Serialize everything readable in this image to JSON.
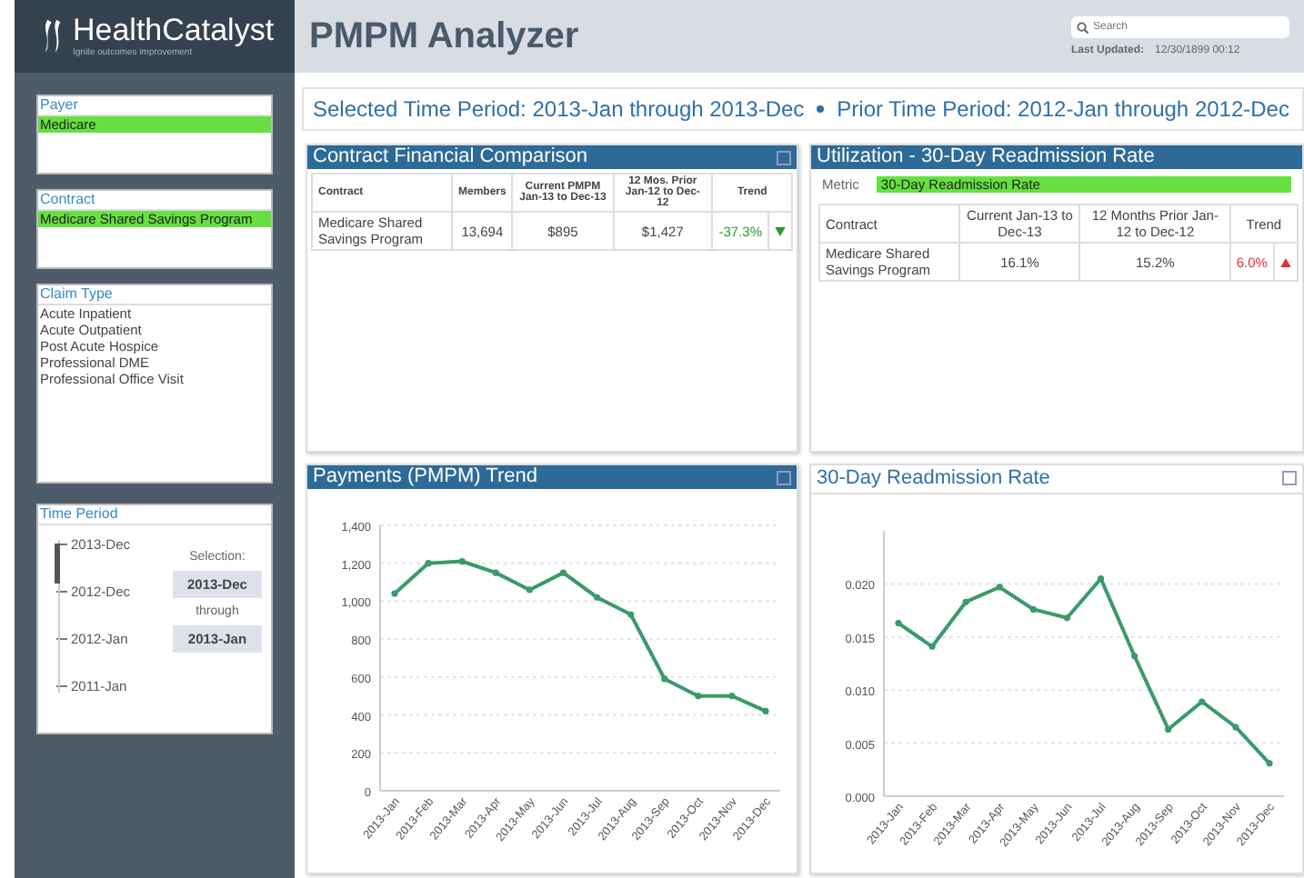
{
  "brand": {
    "name": "HealthCatalyst",
    "tagline": "Ignite outcomes improvement"
  },
  "app_title": "PMPM Analyzer",
  "search": {
    "placeholder": "Search"
  },
  "last_updated": {
    "label": "Last Updated:",
    "value": "12/30/1899 00:12"
  },
  "filters": [
    {
      "title": "Payer",
      "kind": "list",
      "items": [
        {
          "label": "Medicare",
          "selected": true
        }
      ]
    },
    {
      "title": "Contract",
      "kind": "list",
      "items": [
        {
          "label": "Medicare Shared Savings Program",
          "selected": true
        }
      ]
    },
    {
      "title": "Claim Type",
      "kind": "list",
      "items": [
        {
          "label": "Acute Inpatient",
          "selected": false
        },
        {
          "label": "Acute Outpatient",
          "selected": false
        },
        {
          "label": "Post Acute Hospice",
          "selected": false
        },
        {
          "label": "Professional DME",
          "selected": false
        },
        {
          "label": "Professional Office Visit",
          "selected": false
        }
      ]
    }
  ],
  "time_period": {
    "title": "Time Period",
    "ticks": [
      "2013-Dec",
      "2012-Dec",
      "2012-Jan",
      "2011-Jan"
    ],
    "selection_label": "Selection:",
    "from": "2013-Dec",
    "through_label": "through",
    "to": "2013-Jan"
  },
  "period_banner": {
    "selected": "Selected Time Period: 2013-Jan through 2013-Dec",
    "prior": "Prior Time Period: 2012-Jan through 2012-Dec"
  },
  "financial": {
    "title": "Contract Financial Comparison",
    "columns": [
      "Contract",
      "Members",
      "Current PMPM Jan-13 to Dec-13",
      "12 Mos. Prior Jan-12 to Dec-12",
      "Trend"
    ],
    "rows": [
      {
        "contract": "Medicare Shared Savings Program",
        "members": "13,694",
        "current": "$895",
        "prior": "$1,427",
        "trend": "-37.3%",
        "rising": false
      }
    ]
  },
  "utilization": {
    "title": "Utilization - 30-Day Readmission Rate",
    "metric_label": "Metric",
    "metric_value": "30-Day Readmission Rate",
    "columns": [
      "Contract",
      "Current Jan-13 to Dec-13",
      "12 Months Prior Jan-12 to Dec-12",
      "Trend"
    ],
    "rows": [
      {
        "contract": "Medicare Shared Savings Program",
        "current": "16.1%",
        "prior": "15.2%",
        "trend": "6.0%",
        "rising": true
      }
    ]
  },
  "payments": {
    "title": "Payments (PMPM) Trend",
    "chart_data": {
      "type": "line",
      "categories": [
        "2013-Jan",
        "2013-Feb",
        "2013-Mar",
        "2013-Apr",
        "2013-May",
        "2013-Jun",
        "2013-Jul",
        "2013-Aug",
        "2013-Sep",
        "2013-Oct",
        "2013-Nov",
        "2013-Dec"
      ],
      "series": [
        {
          "color": "#3a9a6a",
          "marker": true,
          "values": [
            1040,
            1200,
            1210,
            1150,
            1060,
            1150,
            1020,
            930,
            590,
            500,
            500,
            420
          ]
        }
      ],
      "grid": true,
      "ylim": [
        0,
        1400
      ],
      "yticks": [
        {
          "value": 0,
          "label": "0"
        },
        {
          "value": 200,
          "label": "200"
        },
        {
          "value": 400,
          "label": "400"
        },
        {
          "value": 600,
          "label": "600"
        },
        {
          "value": 800,
          "label": "800"
        },
        {
          "value": 1000,
          "label": "1,000"
        },
        {
          "value": 1200,
          "label": "1,200"
        },
        {
          "value": 1400,
          "label": "1,400"
        }
      ]
    }
  },
  "readmission": {
    "title": "30-Day Readmission Rate",
    "chart_data": {
      "type": "line",
      "categories": [
        "2013-Jan",
        "2013-Feb",
        "2013-Mar",
        "2013-Apr",
        "2013-May",
        "2013-Jun",
        "2013-Jul",
        "2013-Aug",
        "2013-Sep",
        "2013-Oct",
        "2013-Nov",
        "2013-Dec"
      ],
      "series": [
        {
          "color": "#3a9a6a",
          "marker": true,
          "values": [
            0.0163,
            0.0141,
            0.0183,
            0.0197,
            0.0176,
            0.0168,
            0.0205,
            0.0132,
            0.0063,
            0.0089,
            0.0065,
            0.0031
          ]
        }
      ],
      "grid": true,
      "ylim": [
        0,
        0.025
      ],
      "yticks": [
        {
          "value": 0,
          "label": "0.000"
        },
        {
          "value": 0.005,
          "label": "0.005"
        },
        {
          "value": 0.01,
          "label": "0.010"
        },
        {
          "value": 0.015,
          "label": "0.015"
        },
        {
          "value": 0.02,
          "label": "0.020"
        }
      ]
    }
  }
}
